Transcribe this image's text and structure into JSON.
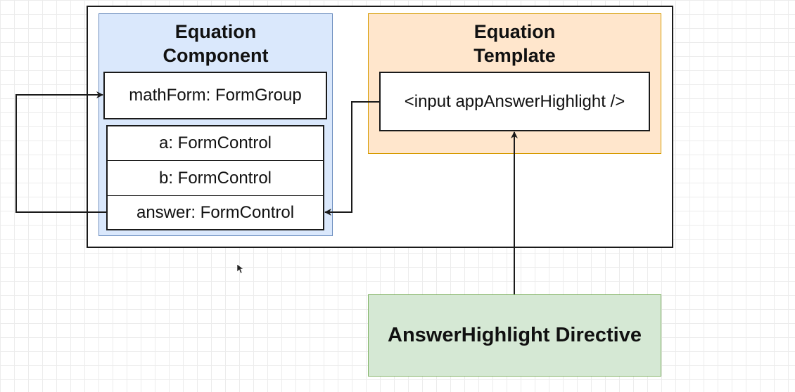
{
  "component": {
    "title_line1": "Equation",
    "title_line2": "Component",
    "form_group": "mathForm: FormGroup",
    "controls": [
      "a: FormControl",
      "b: FormControl",
      "answer: FormControl"
    ]
  },
  "template": {
    "title_line1": "Equation",
    "title_line2": "Template",
    "input_element": "<input appAnswerHighlight />"
  },
  "directive": {
    "label": "AnswerHighlight Directive"
  },
  "colors": {
    "component_fill": "#dae8fc",
    "template_fill": "#ffe6cc",
    "directive_fill": "#d5e8d4"
  }
}
